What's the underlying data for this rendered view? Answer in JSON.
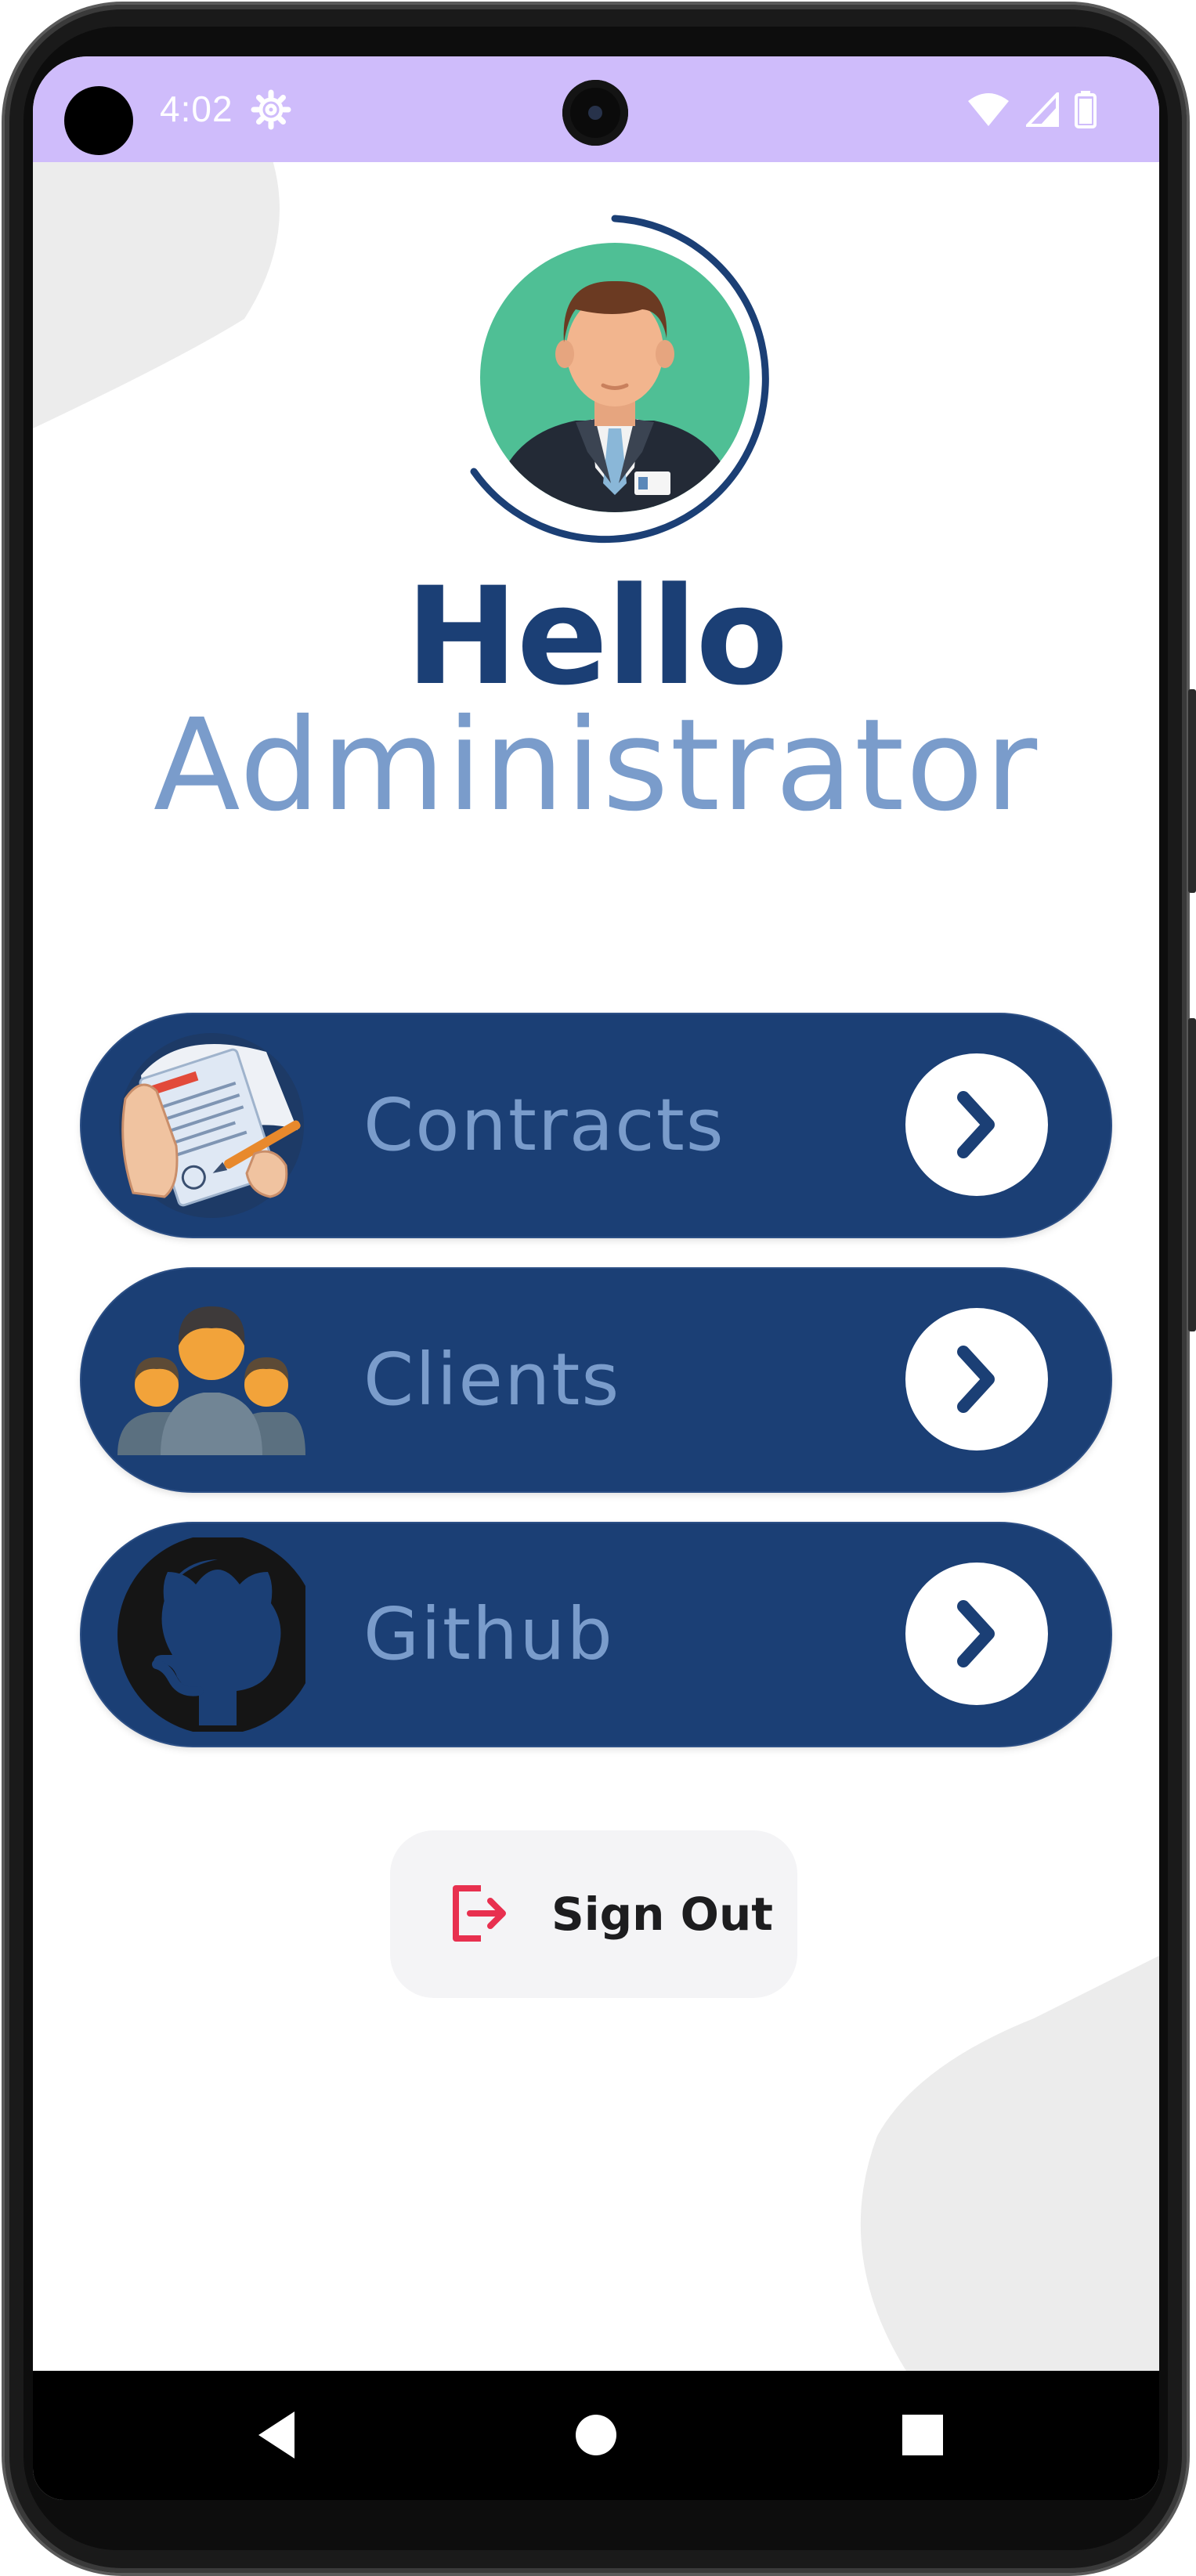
{
  "status_bar": {
    "time": "4:02",
    "background_color": "#cfbcfb",
    "icons": [
      "settings-gear-icon",
      "wifi-icon",
      "cell-signal-icon",
      "battery-icon"
    ]
  },
  "header": {
    "greeting": "Hello",
    "role": "Administrator",
    "greeting_color": "#1b3f75",
    "role_color": "#7a9ccb"
  },
  "menu": {
    "items": [
      {
        "label": "Contracts",
        "icon": "contract-signing-icon"
      },
      {
        "label": "Clients",
        "icon": "clients-group-icon"
      },
      {
        "label": "Github",
        "icon": "github-octocat-icon"
      }
    ],
    "card_color": "#1b3f75",
    "arrow_icon": "chevron-right-icon"
  },
  "sign_out": {
    "label": "Sign Out",
    "icon": "logout-icon",
    "icon_color": "#e8304f"
  },
  "navigation_bar": {
    "buttons": [
      "back-icon",
      "home-icon",
      "recents-icon"
    ]
  }
}
